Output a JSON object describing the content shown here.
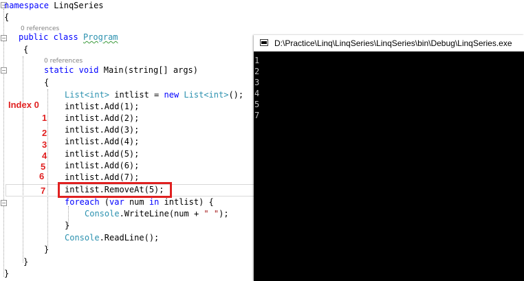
{
  "editor": {
    "namespace_keyword": "namespace",
    "namespace_name": "LinqSeries",
    "open_brace": "{",
    "close_brace": "}",
    "class_refs": "0 references",
    "class_public": "public",
    "class_keyword": "class",
    "class_name": "Program",
    "method_refs": "0 references",
    "method_static": "static",
    "method_void": "void",
    "method_rest": "Main(string[] args)",
    "lines": {
      "decl_type1": "List<int>",
      "decl_mid": " intlist = ",
      "decl_new": "new",
      "decl_type2": " List<int>",
      "decl_end": "();",
      "add1": "intlist.Add(1);",
      "add2": "intlist.Add(2);",
      "add3": "intlist.Add(3);",
      "add4": "intlist.Add(4);",
      "add5": "intlist.Add(5);",
      "add6": "intlist.Add(6);",
      "add7": "intlist.Add(7);",
      "remove": "intlist.RemoveAt(5);",
      "foreach_kw": "foreach",
      "foreach_open": " (",
      "foreach_var": "var",
      "foreach_num": " num ",
      "foreach_in": "in",
      "foreach_rest": " intlist) {",
      "console_type": "Console",
      "writeline_mid": ".WriteLine(num + ",
      "writeline_str": "\" \"",
      "writeline_end": ");",
      "inner_close": "}",
      "readline_type": "Console",
      "readline_rest": ".ReadLine();"
    }
  },
  "annotations": {
    "index_word": "Index 0",
    "i1": "1",
    "i2": "2",
    "i3": "3",
    "i4": "4",
    "i5": "5",
    "i6": "6",
    "i7": "7"
  },
  "console_window": {
    "title": "D:\\Practice\\Linq\\LinqSeries\\LinqSeries\\bin\\Debug\\LinqSeries.exe",
    "output": [
      "1",
      "2",
      "3",
      "4",
      "5",
      "7"
    ]
  },
  "colors": {
    "keyword": "#0000ff",
    "type": "#2b91af",
    "string": "#a31515",
    "annotation": "#e02020",
    "console_bg": "#000000",
    "console_text": "#c0c0c0"
  }
}
